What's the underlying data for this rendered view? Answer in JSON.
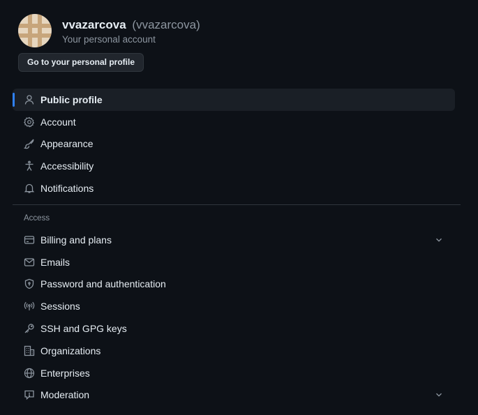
{
  "user": {
    "username": "vvazarcova",
    "handle": "(vvazarcova)",
    "subtitle": "Your personal account",
    "profile_button": "Go to your personal profile"
  },
  "nav_top": [
    {
      "label": "Public profile",
      "icon": "person-icon",
      "active": true
    },
    {
      "label": "Account",
      "icon": "gear-icon"
    },
    {
      "label": "Appearance",
      "icon": "paintbrush-icon"
    },
    {
      "label": "Accessibility",
      "icon": "accessibility-icon"
    },
    {
      "label": "Notifications",
      "icon": "bell-icon"
    }
  ],
  "access": {
    "title": "Access",
    "items": [
      {
        "label": "Billing and plans",
        "icon": "credit-card-icon",
        "expandable": true
      },
      {
        "label": "Emails",
        "icon": "mail-icon"
      },
      {
        "label": "Password and authentication",
        "icon": "shield-lock-icon"
      },
      {
        "label": "Sessions",
        "icon": "broadcast-icon"
      },
      {
        "label": "SSH and GPG keys",
        "icon": "key-icon"
      },
      {
        "label": "Organizations",
        "icon": "organization-icon"
      },
      {
        "label": "Enterprises",
        "icon": "globe-icon"
      },
      {
        "label": "Moderation",
        "icon": "report-icon",
        "expandable": true
      }
    ]
  },
  "colors": {
    "background": "#0d1117",
    "accent": "#2f81f7",
    "muted_text": "#8d96a0"
  }
}
